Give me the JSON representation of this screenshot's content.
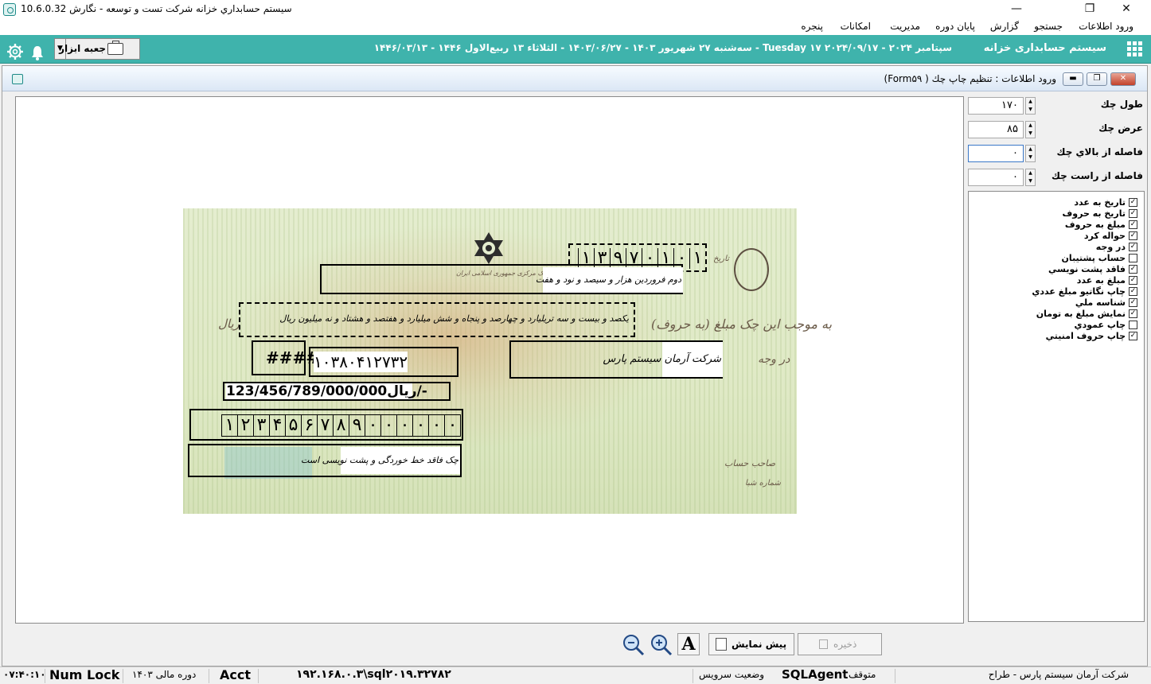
{
  "window": {
    "title": "سيستم حسابداري خزانه شرکت تست و توسعه - نگارش 10.6.0.32",
    "minimize": "—",
    "maximize": "❐",
    "close": "✕"
  },
  "menu": [
    "ورود اطلاعات",
    "جستجو",
    "گزارش",
    "پایان دوره",
    "مدیریت",
    "امکانات",
    "پنجره"
  ],
  "header": {
    "app_title": "سیستم حسابداری خزانه",
    "date_line": "سه‌شنبه ۲۷ شهریور ۱۴۰۳ - ۱۴۰۳/۰۶/۲۷ - الثلاثاء ۱۳ ربیع‌الاول ۱۴۴۶ - ۱۴۴۶/۰۳/۱۳ - Tuesday ۱۷ سپتامبر ۲۰۲۴ - ۲۰۲۴/۰۹/۱۷",
    "toolbox_label": "جعبه ابزار",
    "toolbox_arrow": "▼"
  },
  "form": {
    "title": "ورود اطلاعات : تنظيم چاپ چك ( Form۵۹)"
  },
  "cheque": {
    "date_digits": [
      "۱",
      "۳",
      "۹",
      "۷",
      "۰",
      "۱",
      "۰",
      "۱"
    ],
    "date_words": "دوم فروردین هزار و سیصد و نود و هفت",
    "amount_words": "یکصد و بیست و سه تریلیارد و چهارصد و پنجاه و شش میلیارد و هفتصد و هشتاد و نه میلیون ریال",
    "national_hash": "####",
    "national_code": "۱۰۳۸۰۴۱۲۷۳۲",
    "payee": "شرکت آرمان سیستم پارس",
    "amount_numeric": "123/456/789/000/000ریال/-",
    "amount_digits": [
      "۱",
      "۲",
      "۳",
      "۴",
      "۵",
      "۶",
      "۷",
      "۸",
      "۹",
      "۰",
      "۰",
      "۰",
      "۰",
      "۰",
      "۰"
    ],
    "footer_note": "چک فاقد خط خوردگی و پشت نویسی است",
    "print_date_label": "تاریخ",
    "print_pay_label": "به موجب این چک مبلغ (به حروف)",
    "print_rial": "ریال",
    "print_payee_label": "در وجه",
    "print_owner": "صاحب حساب",
    "print_shaba": "شماره شبا",
    "print_bank": "بانک مرکزی جمهوری اسلامی ایران"
  },
  "settings": {
    "length_label": "طول چك",
    "length_value": "۱۷۰",
    "width_label": "عرض چك",
    "width_value": "۸۵",
    "top_label": "فاصله از بالاي چك",
    "top_value": "۰",
    "right_label": "فاصله از راست چك",
    "right_value": "۰"
  },
  "checklist": [
    {
      "label": "تاریخ به عدد",
      "checked": true
    },
    {
      "label": "تاریخ به حروف",
      "checked": true
    },
    {
      "label": "مبلغ به حروف",
      "checked": true
    },
    {
      "label": "حواله کرد",
      "checked": true
    },
    {
      "label": "در وجه",
      "checked": true
    },
    {
      "label": "حساب پشتیبان",
      "checked": false
    },
    {
      "label": "فاقد پشت نويسي",
      "checked": true
    },
    {
      "label": "مبلغ به عدد",
      "checked": true
    },
    {
      "label": "چاپ نگاتيو مبلغ عددي",
      "checked": true
    },
    {
      "label": "شناسه ملي",
      "checked": true
    },
    {
      "label": "نمايش مبلغ به تومان",
      "checked": true
    },
    {
      "label": "چاپ عمودي",
      "checked": false
    },
    {
      "label": "چاپ حروف امنيتي",
      "checked": true
    }
  ],
  "buttons": {
    "save": "ذخيره",
    "preview": "پيش نمايش",
    "font": "A"
  },
  "status": {
    "company": "شرکت آرمان سیستم پارس - طراح",
    "sqlagent_state": "متوقف",
    "sqlagent_name": "SQLAgent",
    "sqlagent_label": "وضعيت سرويس",
    "server": "۱۹۲.۱۶۸.۰.۳\\sql۲۰۱۹.۳۲۷۸۲",
    "acct": "Acct",
    "fiscal": "دوره مالی ۱۴۰۳",
    "numlock": "Num Lock",
    "clock": "۰۷:۴۰:۱۰"
  },
  "colors": {
    "header_teal": "#3fb3ac",
    "canvas_bg": "#ffffff",
    "cheque_green": "#dfe9c5"
  }
}
